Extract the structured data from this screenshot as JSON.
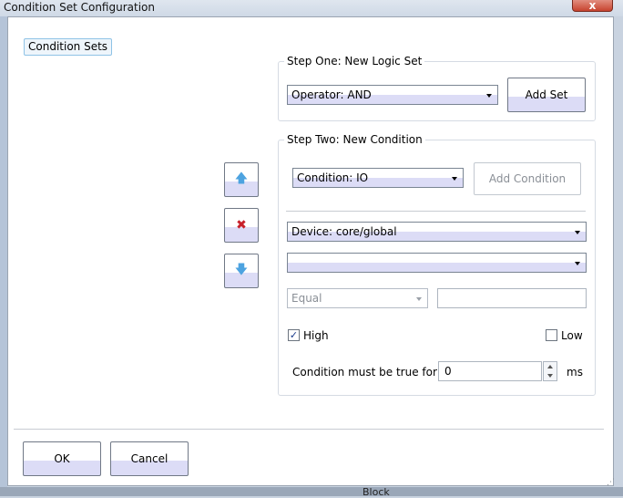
{
  "window": {
    "title": "Condition Set Configuration",
    "close_glyph": "x"
  },
  "tabs": {
    "condition_sets": "Condition Sets"
  },
  "step_one": {
    "title": "Step One: New Logic Set",
    "operator_value": "Operator: AND",
    "add_set_label": "Add Set"
  },
  "step_two": {
    "title": "Step Two: New Condition",
    "condition_value": "Condition: IO",
    "add_condition_label": "Add Condition",
    "device_value": "Device: core/global",
    "io_value": "",
    "comparison_value": "Equal",
    "comparison_text": "",
    "high_label": "High",
    "high_checked": true,
    "check_glyph": "✓",
    "low_label": "Low",
    "low_checked": false,
    "duration_label": "Condition must be true for",
    "duration_value": "0",
    "duration_unit": "ms"
  },
  "side_buttons": {
    "up_glyph": "🡅",
    "delete_glyph": "✖",
    "down_glyph": "🡇"
  },
  "footer": {
    "ok_label": "OK",
    "cancel_label": "Cancel"
  },
  "background": {
    "block_text": "Block"
  },
  "colors": {
    "up_arrow": "#4da3e0",
    "delete": "#c8202a",
    "down_arrow": "#4da3e0"
  }
}
